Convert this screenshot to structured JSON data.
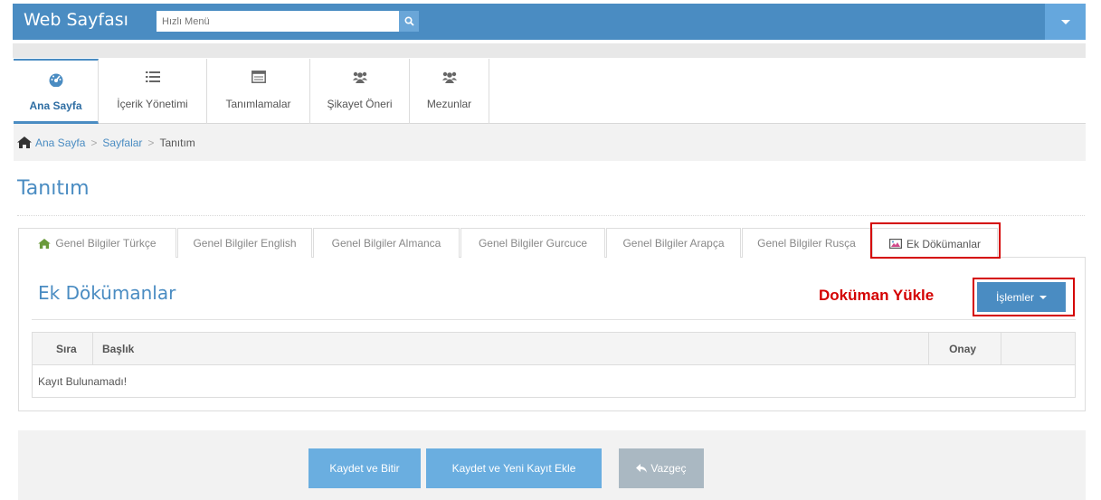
{
  "header": {
    "brand": "Web Sayfası",
    "search_placeholder": "Hızlı Menü",
    "search_icon": "search-icon",
    "menu_icon": "caret-down-icon",
    "accent_color": "#4a8cc2"
  },
  "nav": {
    "items": [
      {
        "label": "Ana Sayfa",
        "icon": "dashboard-icon",
        "active": true
      },
      {
        "label": "İçerik Yönetimi",
        "icon": "list-icon",
        "active": false
      },
      {
        "label": "Tanımlamalar",
        "icon": "window-icon",
        "active": false
      },
      {
        "label": "Şikayet Öneri",
        "icon": "users-icon",
        "active": false
      },
      {
        "label": "Mezunlar",
        "icon": "users-icon",
        "active": false
      }
    ]
  },
  "breadcrumb": {
    "home": "Ana Sayfa",
    "section": "Sayfalar",
    "current": "Tanıtım",
    "separator": ">"
  },
  "page": {
    "title": "Tanıtım"
  },
  "tabs": [
    {
      "label": "Genel Bilgiler Türkçe",
      "icon": "home-icon"
    },
    {
      "label": "Genel Bilgiler English"
    },
    {
      "label": "Genel Bilgiler Almanca"
    },
    {
      "label": "Genel Bilgiler Gurcuce"
    },
    {
      "label": "Genel Bilgiler Arapça"
    },
    {
      "label": "Genel Bilgiler Rusça"
    },
    {
      "label": "Ek Dökümanlar",
      "icon": "image-icon",
      "active": true
    }
  ],
  "panel": {
    "title": "Ek Dökümanlar",
    "annotation": "Doküman Yükle",
    "ops_label": "İşlemler",
    "table": {
      "headers": [
        "Sıra",
        "Başlık",
        "Onay",
        ""
      ],
      "empty_message": "Kayıt Bulunamadı!"
    }
  },
  "footer": {
    "save_finish": "Kaydet ve Bitir",
    "save_new": "Kaydet ve Yeni Kayıt Ekle",
    "cancel": "Vazgeç"
  }
}
